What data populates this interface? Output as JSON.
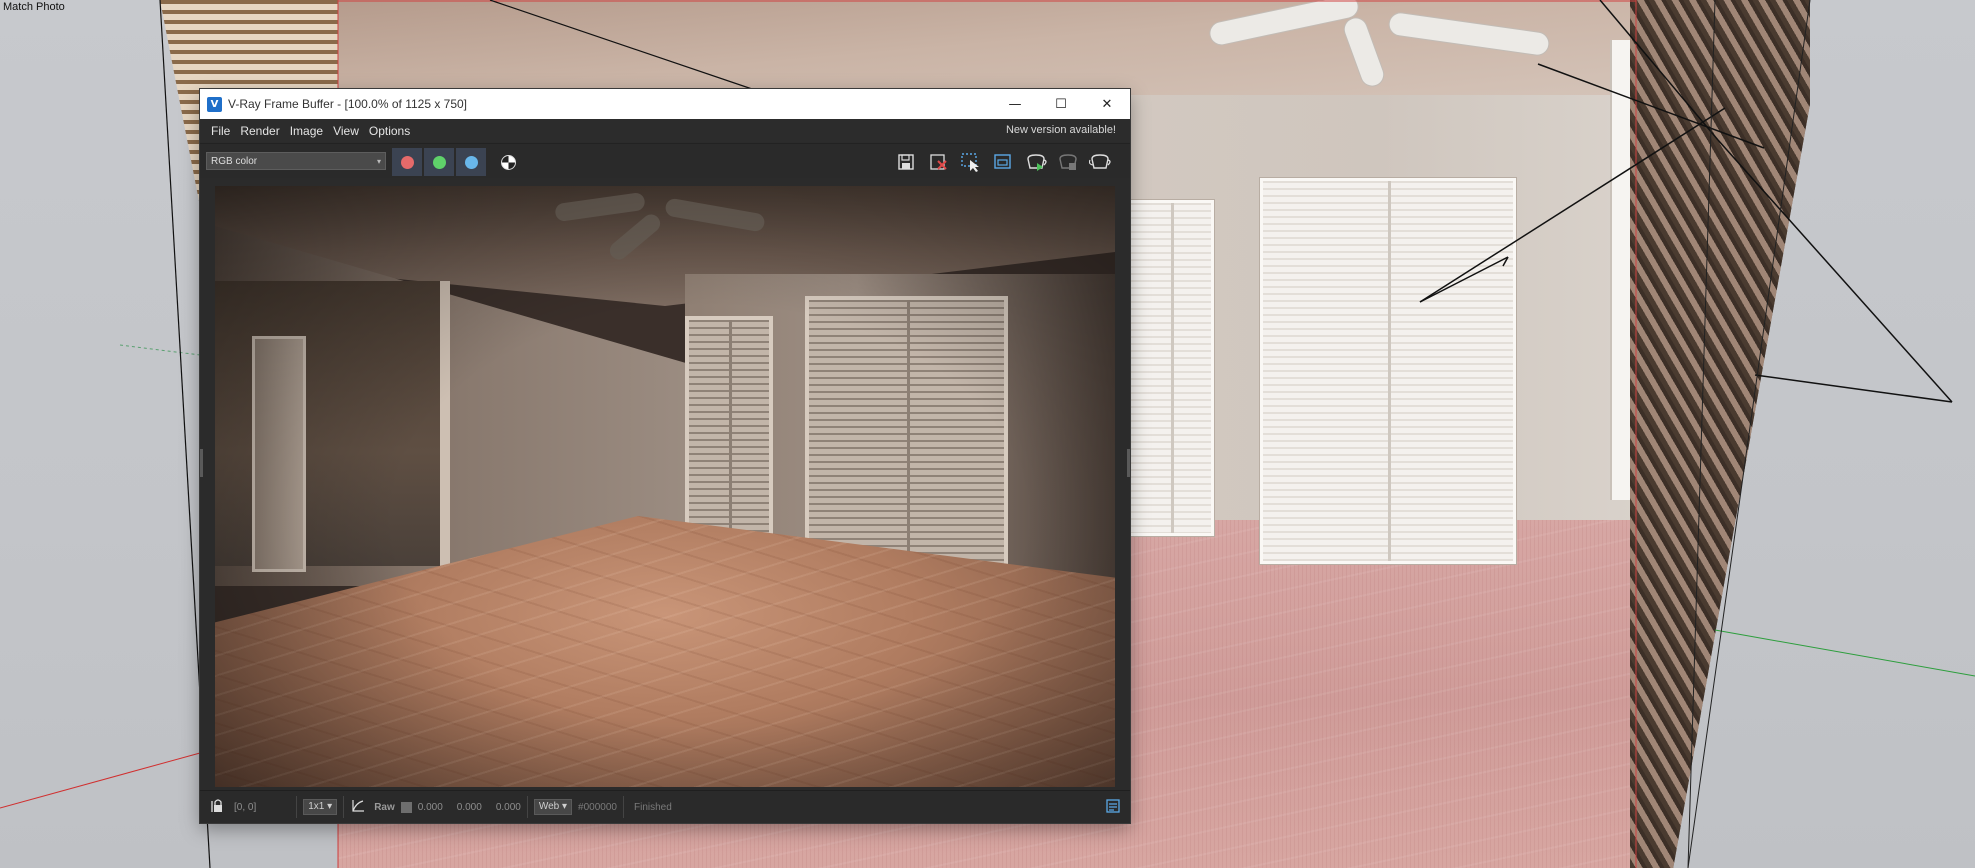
{
  "scene": {
    "tab_label": "Match Photo"
  },
  "vfb": {
    "title": "V-Ray Frame Buffer - [100.0% of 1125 x 750]",
    "app_icon": "vray-logo-icon",
    "window_controls": {
      "minimize": "—",
      "maximize": "☐",
      "close": "✕"
    },
    "menu": [
      "File",
      "Render",
      "Image",
      "View",
      "Options"
    ],
    "update_notice": "New version available!",
    "toolbar": {
      "channel": "RGB color",
      "channels": [
        {
          "name": "red-channel",
          "color": "#e56a6a"
        },
        {
          "name": "green-channel",
          "color": "#5fd16a"
        },
        {
          "name": "blue-channel",
          "color": "#69b7ea"
        }
      ],
      "right_icons": [
        "save-image-icon",
        "clear-image-icon",
        "region-render-icon",
        "track-mouse-icon",
        "start-interactive-icon",
        "stop-render-icon",
        "render-icon"
      ]
    },
    "status": {
      "coords": "[0, 0]",
      "zoom": "1x1",
      "mode": "Raw",
      "r": "0.000",
      "g": "0.000",
      "b": "0.000",
      "color_space": "Web",
      "hex": "#000000",
      "state": "Finished"
    }
  }
}
